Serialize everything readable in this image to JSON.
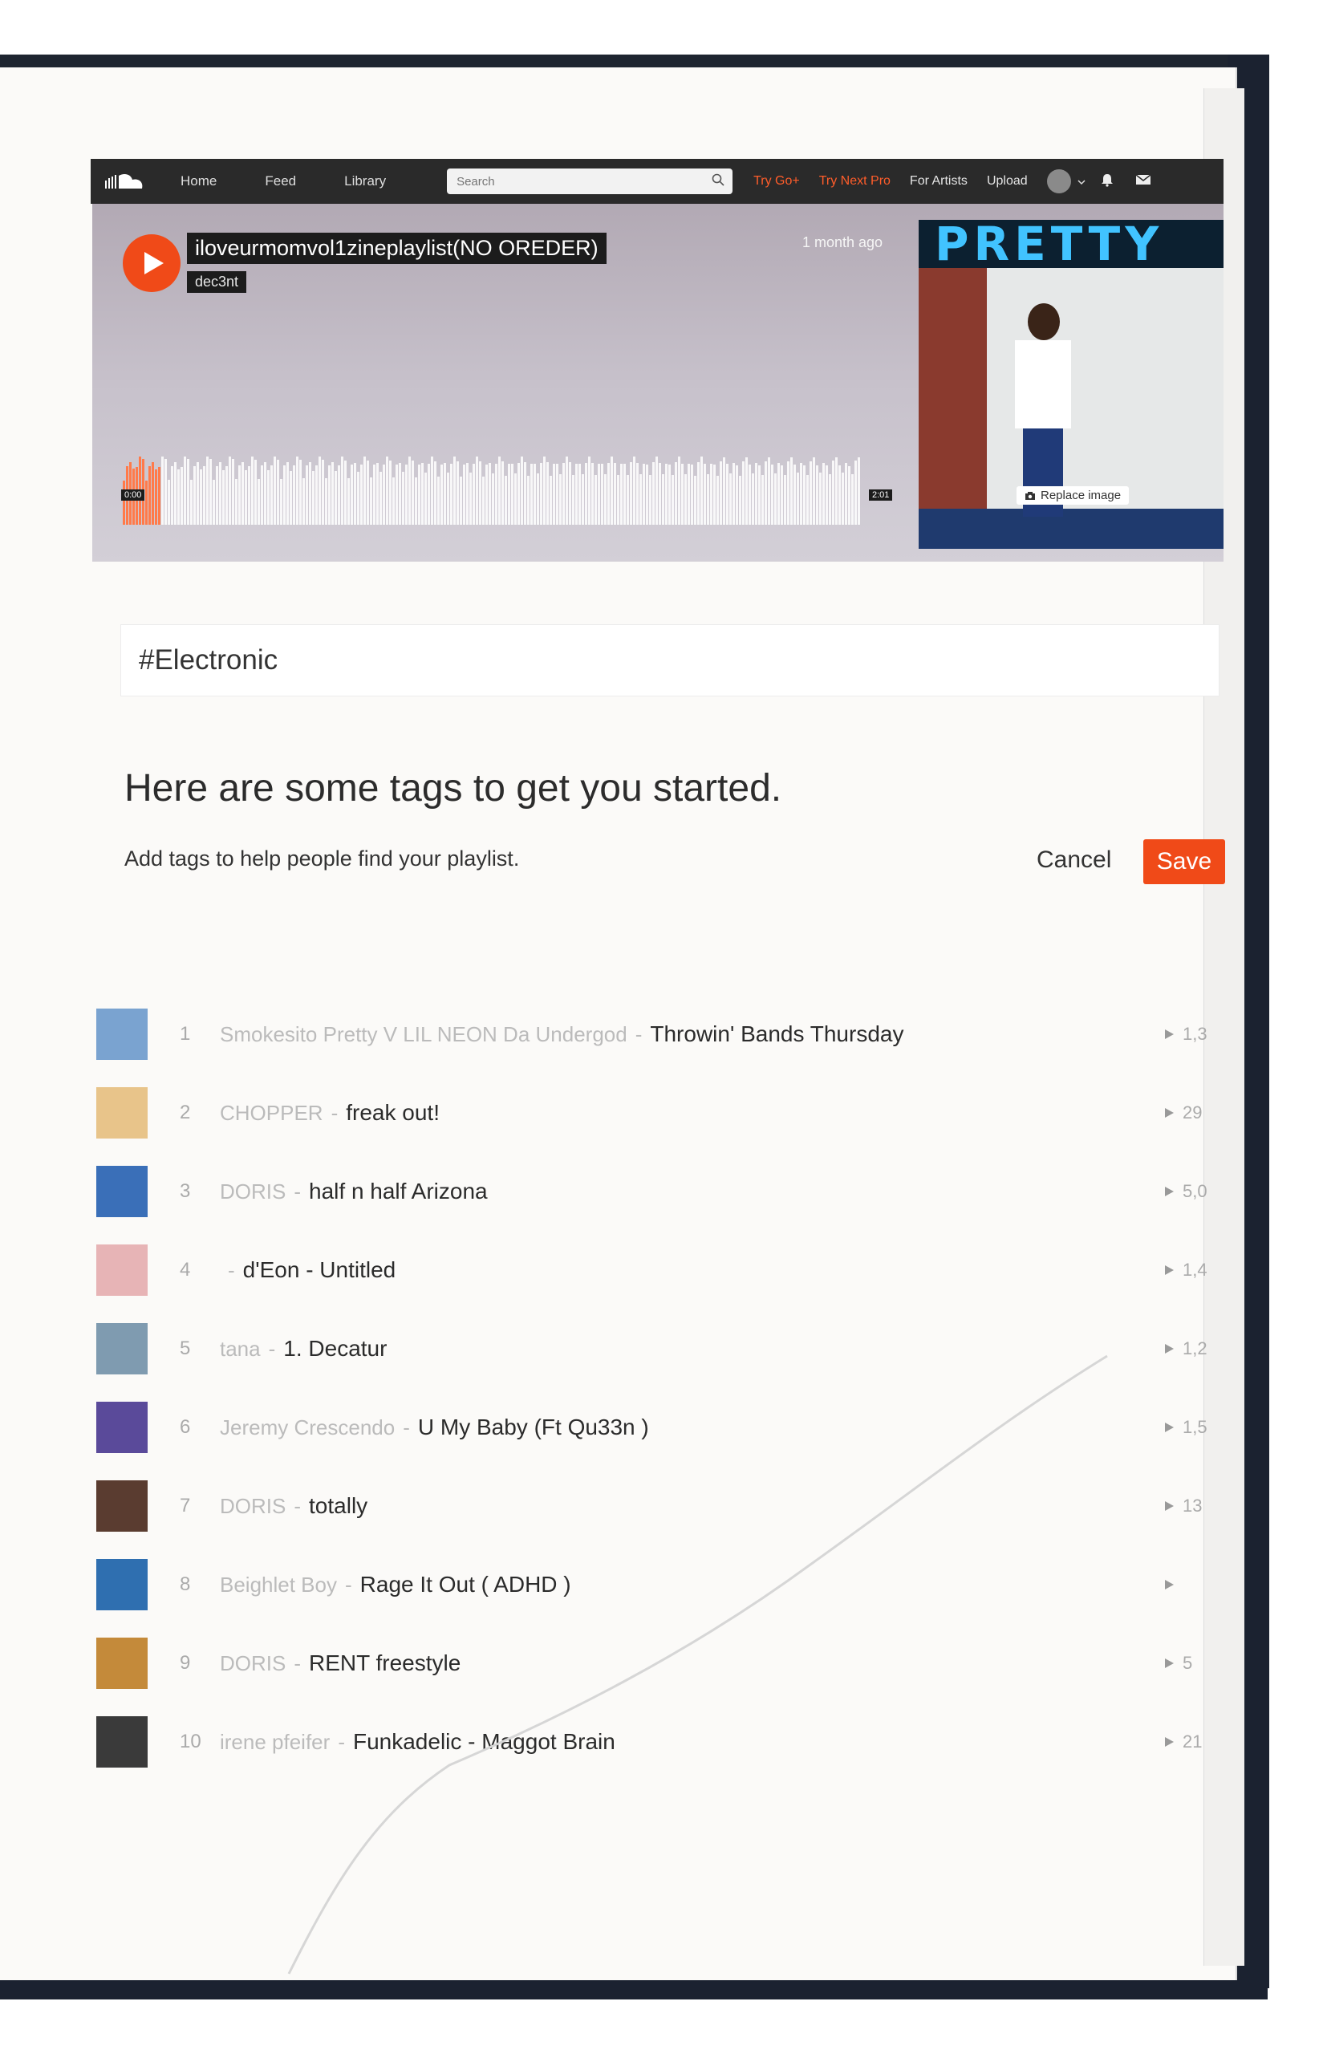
{
  "nav": {
    "home": "Home",
    "feed": "Feed",
    "library": "Library",
    "search_placeholder": "Search",
    "try_go": "Try Go+",
    "try_next_pro": "Try Next Pro",
    "for_artists": "For Artists",
    "upload": "Upload",
    "colors": {
      "bar": "#2a2a2a",
      "accent": "#ff5d2a"
    }
  },
  "hero": {
    "title": "iloveurmomvol1zineplaylist(NO OREDER)",
    "user": "dec3nt",
    "date": "1 month ago",
    "time_start": "0:00",
    "time_end": "2:01",
    "artwork_banner": "PRETTY",
    "replace_image": "Replace image",
    "play_color": "#f04a18"
  },
  "tags": {
    "value": "#Electronic",
    "heading": "Here are some tags to get you started.",
    "subheading": "Add tags to help people find your playlist.",
    "cancel": "Cancel",
    "save": "Save"
  },
  "tracks": [
    {
      "num": "1",
      "artist": "Smokesito Pretty V LIL NEON Da Undergod",
      "title": "Throwin' Bands Thursday",
      "plays": "1,3",
      "thumb": "#7aa3d0"
    },
    {
      "num": "2",
      "artist": "CHOPPER",
      "title": "freak out!",
      "plays": "29",
      "thumb": "#e8c48a"
    },
    {
      "num": "3",
      "artist": "DORIS",
      "title": "half n half Arizona",
      "plays": "5,0",
      "thumb": "#3a6fb8"
    },
    {
      "num": "4",
      "artist": "",
      "title": "d'Eon - Untitled",
      "plays": "1,4",
      "thumb": "#e7b4b6"
    },
    {
      "num": "5",
      "artist": "tana",
      "title": "1. Decatur",
      "plays": "1,2",
      "thumb": "#7f9bb0"
    },
    {
      "num": "6",
      "artist": "Jeremy Crescendo",
      "title": "U My Baby (Ft Qu33n )",
      "plays": "1,5",
      "thumb": "#5a4a9a"
    },
    {
      "num": "7",
      "artist": "DORIS",
      "title": "totally",
      "plays": "13",
      "thumb": "#5a3c30"
    },
    {
      "num": "8",
      "artist": "Beighlet Boy",
      "title": "Rage It Out ( ADHD )",
      "plays": "",
      "thumb": "#2f6fb0"
    },
    {
      "num": "9",
      "artist": "DORIS",
      "title": "RENT freestyle",
      "plays": "5",
      "thumb": "#c48a3a"
    },
    {
      "num": "10",
      "artist": "irene pfeifer",
      "title": "Funkadelic - Maggot Brain",
      "plays": "21",
      "thumb": "#3a3a3a"
    }
  ]
}
